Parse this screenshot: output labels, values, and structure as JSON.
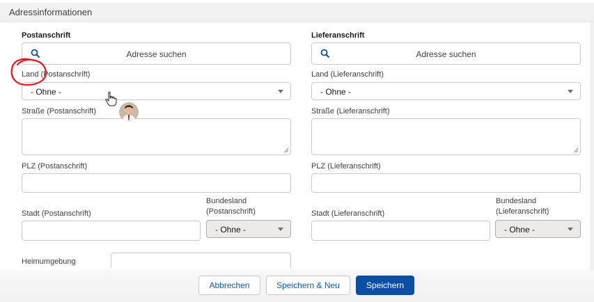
{
  "section": {
    "title": "Adressinformationen"
  },
  "postal": {
    "heading": "Postanschrift",
    "search_label": "Adresse suchen",
    "country_label": "Land (Postanschrift)",
    "country_value": "- Ohne -",
    "street_label": "Straße (Postanschrift)",
    "zip_label": "PLZ (Postanschrift)",
    "city_label": "Stadt (Postanschrift)",
    "state_label_line1": "Bundesland",
    "state_label_line2": "(Postanschrift)",
    "state_value": "- Ohne -",
    "neighborhood_label": "Heimumgebung"
  },
  "shipping": {
    "heading": "Lieferanschrift",
    "search_label": "Adresse suchen",
    "country_label": "Land (Lieferanschrift)",
    "country_value": "- Ohne -",
    "street_label": "Straße (Lieferanschrift)",
    "zip_label": "PLZ (Lieferanschrift)",
    "city_label": "Stadt (Lieferanschrift)",
    "state_label_line1": "Bundesland",
    "state_label_line2": "(Lieferanschrift)",
    "state_value": "- Ohne -"
  },
  "footer": {
    "cancel_label": "Abbrechen",
    "save_new_label": "Speichern & Neu",
    "save_label": "Speichern"
  },
  "colors": {
    "brand": "#0b4ea2",
    "annotation": "#e8141b"
  },
  "icons": {
    "search": "search-icon",
    "dropdown": "chevron-down-icon",
    "cursor": "hand-pointer-icon"
  }
}
